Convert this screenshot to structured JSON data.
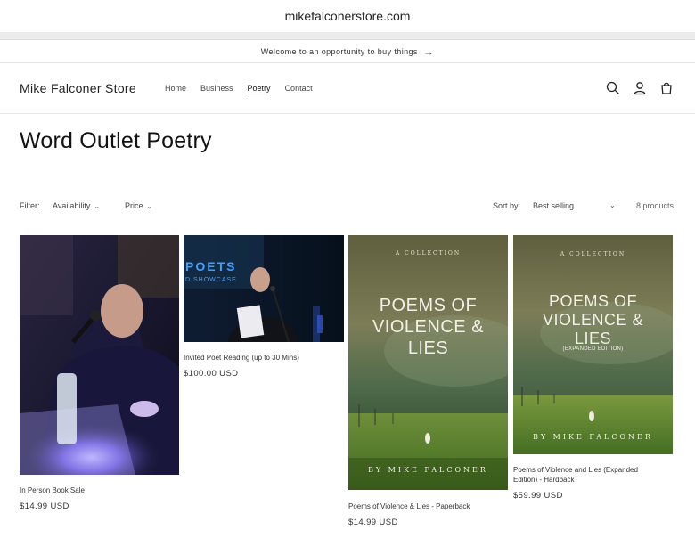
{
  "browser": {
    "url": "mikefalconerstore.com"
  },
  "announcement": {
    "text": "Welcome to an opportunity to buy things",
    "arrow": "→"
  },
  "header": {
    "logo": "Mike Falconer Store",
    "nav": [
      "Home",
      "Business",
      "Poetry",
      "Contact"
    ],
    "active_nav": "Poetry",
    "icons": [
      "search-icon",
      "account-icon",
      "cart-icon"
    ]
  },
  "collection": {
    "title": "Word Outlet Poetry",
    "filter_label": "Filter:",
    "filters": [
      "Availability",
      "Price"
    ],
    "sort_label": "Sort by:",
    "sort_value": "Best selling",
    "product_count": "8 products"
  },
  "products": [
    {
      "title": "In Person Book Sale",
      "price": "$14.99 USD"
    },
    {
      "title": "Invited Poet Reading (up to 30 Mins)",
      "price": "$100.00 USD",
      "banner_text": "POETS",
      "banner_sub": "D SHOWCASE"
    },
    {
      "title": "Poems of Violence & Lies - Paperback",
      "price": "$14.99 USD",
      "cover": {
        "top": "A COLLECTION",
        "lines": [
          "POEMS OF",
          "VIOLENCE &",
          "LIES"
        ],
        "author": "BY MIKE FALCONER"
      }
    },
    {
      "title_lines": [
        "Poems of Violence and Lies (Expanded",
        "Edition) - Hardback"
      ],
      "price": "$59.99 USD",
      "cover": {
        "top": "A COLLECTION",
        "lines": [
          "POEMS OF",
          "VIOLENCE &",
          "LIES"
        ],
        "edition": "(EXPANDED EDITION)",
        "author": "BY MIKE FALCONER"
      }
    }
  ],
  "colors": {
    "text": "#121212",
    "muted": "#444444",
    "border": "#e6e6e6"
  }
}
